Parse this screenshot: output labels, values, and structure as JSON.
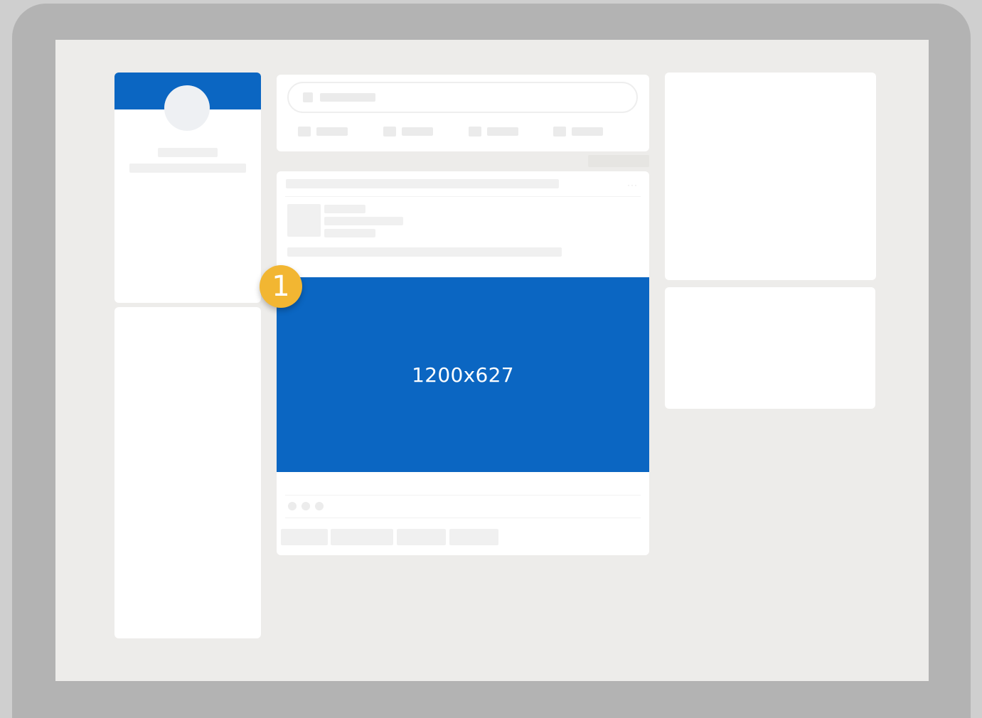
{
  "colors": {
    "brand_blue": "#0b66c2",
    "badge_yellow": "#f2b632",
    "screen_bg": "#edecea",
    "frame": "#b3b3b3"
  },
  "post": {
    "image_label": "1200x627"
  },
  "badge": {
    "number": "1"
  },
  "icons": {
    "overflow_menu": "···"
  }
}
